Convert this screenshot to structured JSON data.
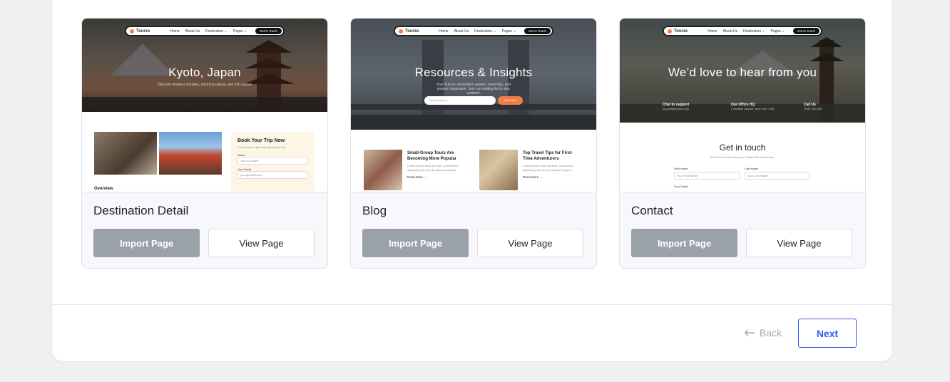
{
  "cards": [
    {
      "title": "Destination Detail",
      "import_label": "Import Page",
      "view_label": "View Page",
      "preview": {
        "brand": "Tourze",
        "nav": [
          "Home",
          "About Us",
          "Destination ⌄",
          "Pages ⌄"
        ],
        "cta": "Get in Touch",
        "hero_title": "Kyoto, Japan",
        "hero_sub": "Discover timeless temples, stunning nature, and rich culture",
        "booking_title": "Book Your Trip Now",
        "booking_sub": "Let us know a bit more about your trip",
        "name_label": "Name",
        "name_placeholder": "Your full name",
        "email_label": "Your Email",
        "email_placeholder": "your@email.com",
        "overview": "Overview"
      }
    },
    {
      "title": "Blog",
      "import_label": "Import Page",
      "view_label": "View Page",
      "preview": {
        "brand": "Tourze",
        "nav": [
          "Home",
          "About Us",
          "Destination ⌄",
          "Pages ⌄"
        ],
        "cta": "Get in Touch",
        "hero_title": "Resources & Insights",
        "hero_sub": "Your hub for destination guides, travel tips, and journey inspiration. Join our mailing list to stay updated.",
        "email_placeholder": "Email Address",
        "subscribe": "Subscribe",
        "posts": [
          {
            "title": "Small-Group Tours Are Becoming More Popular",
            "excerpt": "Lorem ipsum dolor sit amet, consectetur adipiscing elit, sed do eiusmod tempor.",
            "more": "Read More →"
          },
          {
            "title": "Top Travel Tips for First-Time Adventurers",
            "excerpt": "Lorem ipsum dolor sit amet, consectetur adipiscing elit, sed do eiusmod tempor.",
            "more": "Read More →"
          }
        ]
      }
    },
    {
      "title": "Contact",
      "import_label": "Import Page",
      "view_label": "View Page",
      "preview": {
        "brand": "Tourze",
        "nav": [
          "Home",
          "About Us",
          "Destination ⌄",
          "Pages ⌄"
        ],
        "cta": "Get in Touch",
        "hero_title": "We’d love to hear from you",
        "contacts": [
          {
            "label": "Chat to support",
            "value": "support@tourze.com"
          },
          {
            "label": "Our Office HQ",
            "value": "2 Boulder Square, New York, USA"
          },
          {
            "label": "Call Us",
            "value": "1000 123 4567"
          }
        ],
        "form_title": "Get in touch",
        "form_sub": "We’d love to hear from you. Please fill out this form.",
        "first_name": "First Name",
        "first_placeholder": "Your First Name",
        "last_name": "Last Name",
        "last_placeholder": "Your Last Name",
        "email_label": "Your Email"
      }
    }
  ],
  "footer": {
    "back_label": "Back",
    "next_label": "Next"
  },
  "colors": {
    "accent": "#3858e9",
    "import_button": "#9aa1a8",
    "brand_orange": "#f47c4b"
  }
}
